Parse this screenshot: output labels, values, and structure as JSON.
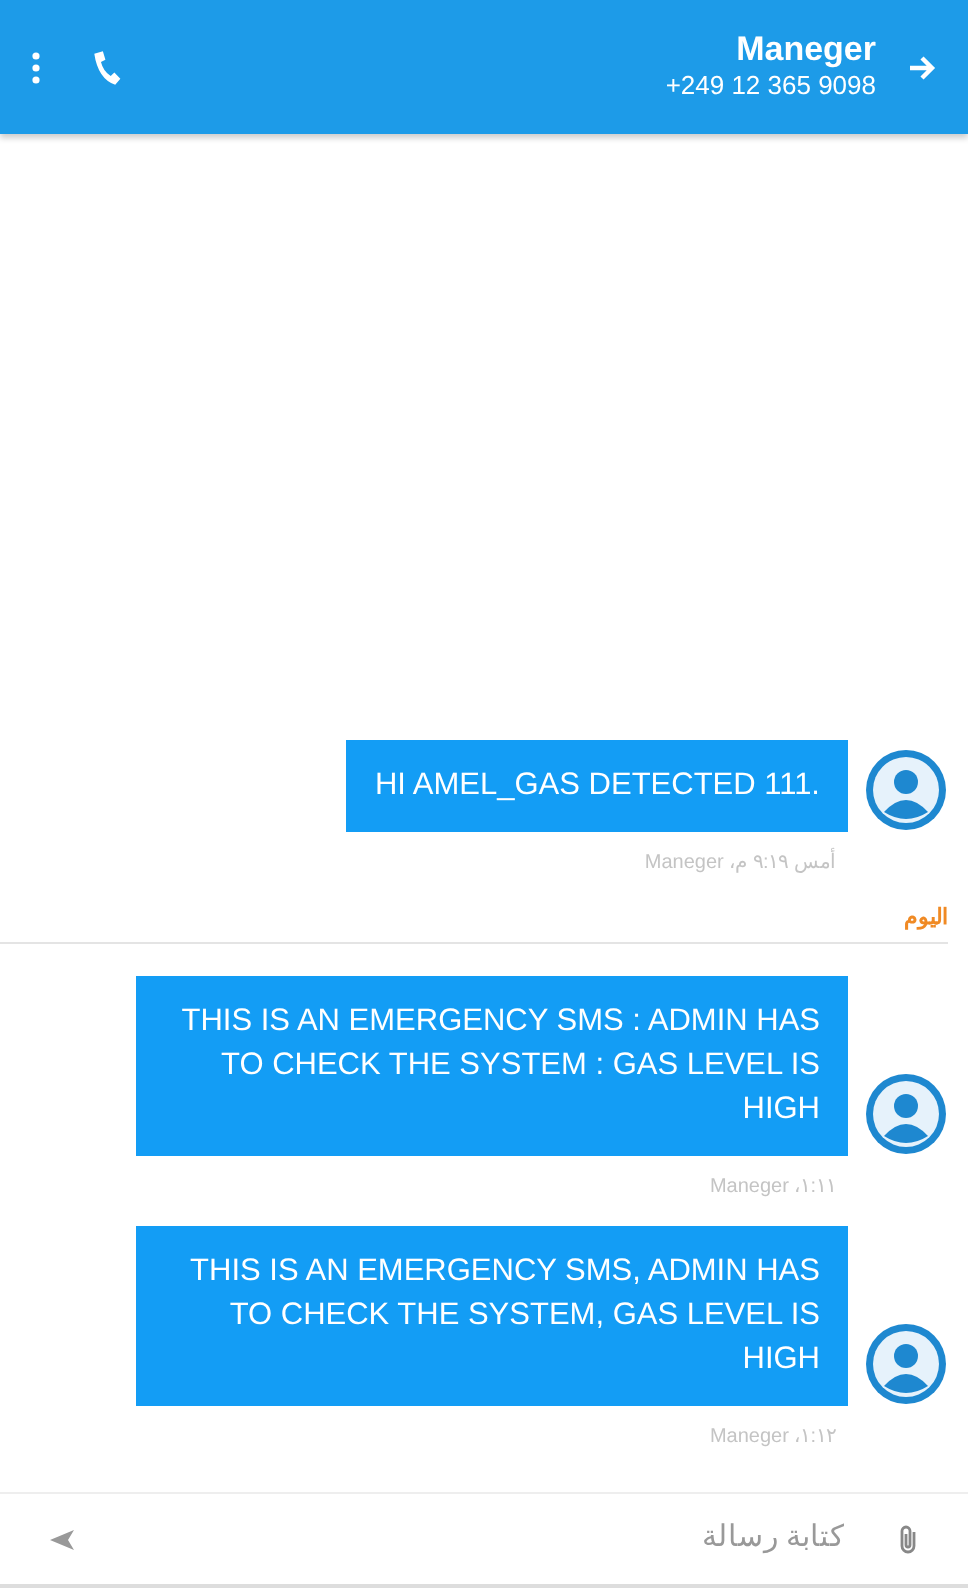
{
  "header": {
    "contact_name": "Maneger",
    "phone_number": "+249 12 365 9098"
  },
  "messages": [
    {
      "kind": "message",
      "text": "HI AMEL_GAS DETECTED 111.",
      "meta": "أمس ٩:١٩ م، Maneger"
    },
    {
      "kind": "separator",
      "text": "اليوم"
    },
    {
      "kind": "message",
      "text": "THIS IS AN EMERGENCY SMS : ADMIN HAS TO CHECK THE SYSTEM : GAS LEVEL IS HIGH",
      "meta": "Maneger ،١:١١"
    },
    {
      "kind": "message",
      "text": "THIS IS AN EMERGENCY SMS, ADMIN HAS TO CHECK THE SYSTEM, GAS LEVEL IS HIGH",
      "meta": "Maneger ،١:١٢"
    }
  ],
  "composer": {
    "placeholder": "كتابة رسالة"
  }
}
